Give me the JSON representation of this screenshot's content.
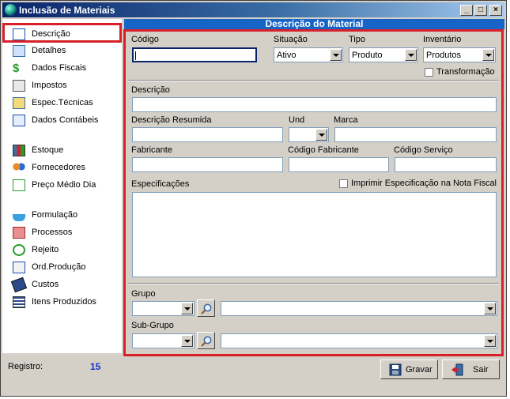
{
  "window": {
    "title": "Inclusão de Materiais"
  },
  "sidebar": {
    "items": [
      {
        "label": "Descrição"
      },
      {
        "label": "Detalhes"
      },
      {
        "label": "Dados Fiscais"
      },
      {
        "label": "Impostos"
      },
      {
        "label": "Espec.Técnicas"
      },
      {
        "label": "Dados Contábeis"
      },
      {
        "label": "Estoque"
      },
      {
        "label": "Fornecedores"
      },
      {
        "label": "Preço Médio Dia"
      },
      {
        "label": "Formulação"
      },
      {
        "label": "Processos"
      },
      {
        "label": "Rejeito"
      },
      {
        "label": "Ord.Produção"
      },
      {
        "label": "Custos"
      },
      {
        "label": "Itens Produzidos"
      }
    ],
    "selected": "Descrição"
  },
  "footer": {
    "registro_label": "Registro:",
    "registro_count": "15"
  },
  "panel": {
    "title": "Descrição do Material",
    "codigo": {
      "label": "Código",
      "value": ""
    },
    "situacao": {
      "label": "Situação",
      "value": "Ativo"
    },
    "tipo": {
      "label": "Tipo",
      "value": "Produto"
    },
    "inventario": {
      "label": "Inventário",
      "value": "Produtos"
    },
    "transformacao": {
      "label": "Transformação",
      "checked": false
    },
    "descricao": {
      "label": "Descrição",
      "value": ""
    },
    "descricao_resumida": {
      "label": "Descrição Resumida",
      "value": ""
    },
    "und": {
      "label": "Und",
      "value": ""
    },
    "marca": {
      "label": "Marca",
      "value": ""
    },
    "fabricante": {
      "label": "Fabricante",
      "value": ""
    },
    "codigo_fabricante": {
      "label": "Código Fabricante",
      "value": ""
    },
    "codigo_servico": {
      "label": "Código Serviço",
      "value": ""
    },
    "especificacoes": {
      "label": "Especificações",
      "value": ""
    },
    "imprimir_especificacao": {
      "label": "Imprimir Especificação na Nota Fiscal",
      "checked": false
    },
    "grupo": {
      "label": "Grupo",
      "code": "",
      "name": ""
    },
    "sub_grupo": {
      "label": "Sub-Grupo",
      "code": "",
      "name": ""
    }
  },
  "buttons": {
    "gravar": "Gravar",
    "sair": "Sair"
  },
  "colors": {
    "highlight": "#d8202a",
    "panel_header": "#1665c6",
    "count": "#1530c8"
  }
}
